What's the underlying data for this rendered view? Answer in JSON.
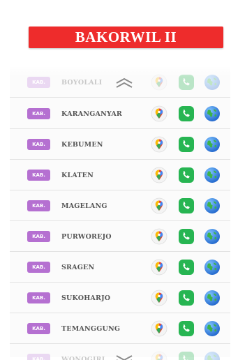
{
  "header": {
    "title": "BAKORWIL II"
  },
  "badge_label": "KAB.",
  "colors": {
    "banner": "#ee2c2c",
    "badge": "#b570d1",
    "phone": "#27b552",
    "globe": "#1a6fd6"
  },
  "rows": [
    {
      "name": "BOYOLALI",
      "faded": true,
      "scroll": "up"
    },
    {
      "name": "KARANGANYAR"
    },
    {
      "name": "KEBUMEN"
    },
    {
      "name": "KLATEN"
    },
    {
      "name": "MAGELANG"
    },
    {
      "name": "PURWOREJO"
    },
    {
      "name": "SRAGEN"
    },
    {
      "name": "SUKOHARJO"
    },
    {
      "name": "TEMANGGUNG"
    },
    {
      "name": "WONOGIRI",
      "faded": true,
      "scroll": "down"
    }
  ],
  "icons": [
    "map-pin-icon",
    "phone-icon",
    "globe-icon"
  ]
}
